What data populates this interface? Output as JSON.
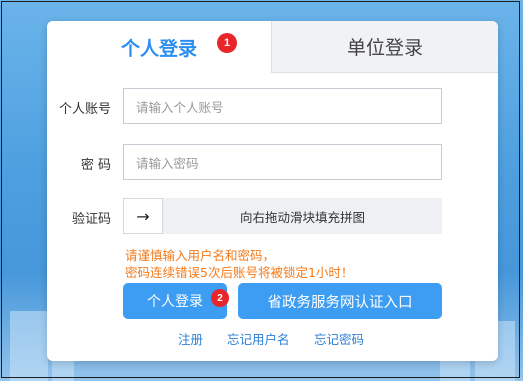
{
  "tabs": {
    "personal": "个人登录",
    "unit": "单位登录",
    "personal_badge": "1"
  },
  "form": {
    "account_label": "个人账号",
    "account_placeholder": "请输入个人账号",
    "password_label": "密 码",
    "password_placeholder": "请输入密码",
    "captcha_label": "验证码",
    "slider_arrow": "→",
    "slider_text": "向右拖动滑块填充拼图"
  },
  "warning": {
    "line1": "请谨慎输入用户名和密码，",
    "line2": "密码连续错误5次后账号将被锁定1小时！"
  },
  "buttons": {
    "login": "个人登录",
    "login_badge": "2",
    "gov_auth": "省政务服务网认证入口"
  },
  "links": {
    "register": "注册",
    "forgot_username": "忘记用户名",
    "forgot_password": "忘记密码"
  },
  "colors": {
    "accent": "#2c8ef0",
    "button": "#3d9df2",
    "warning": "#f47a1a",
    "badge": "#e8262a"
  }
}
